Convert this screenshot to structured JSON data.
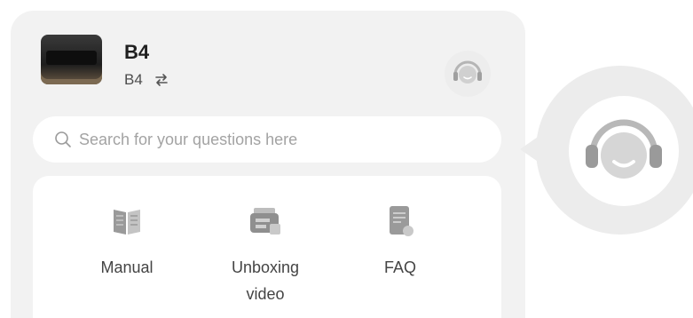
{
  "device": {
    "title": "B4",
    "model": "B4"
  },
  "search": {
    "placeholder": "Search for your questions here"
  },
  "quick_links": [
    {
      "label": "Manual",
      "icon": "book-icon"
    },
    {
      "label": "Unboxing video",
      "icon": "package-icon"
    },
    {
      "label": "FAQ",
      "icon": "document-icon"
    }
  ],
  "icons": {
    "support_small": "headset-support-icon",
    "support_large": "headset-support-icon",
    "swap": "swap-arrows-icon",
    "search": "search-icon"
  },
  "colors": {
    "panel": "#f2f2f2",
    "card": "#ffffff",
    "text_primary": "#1f1f1f",
    "text_secondary": "#4d4d4d",
    "placeholder": "#a3a3a3",
    "icon_gray": "#8c8c8c"
  }
}
